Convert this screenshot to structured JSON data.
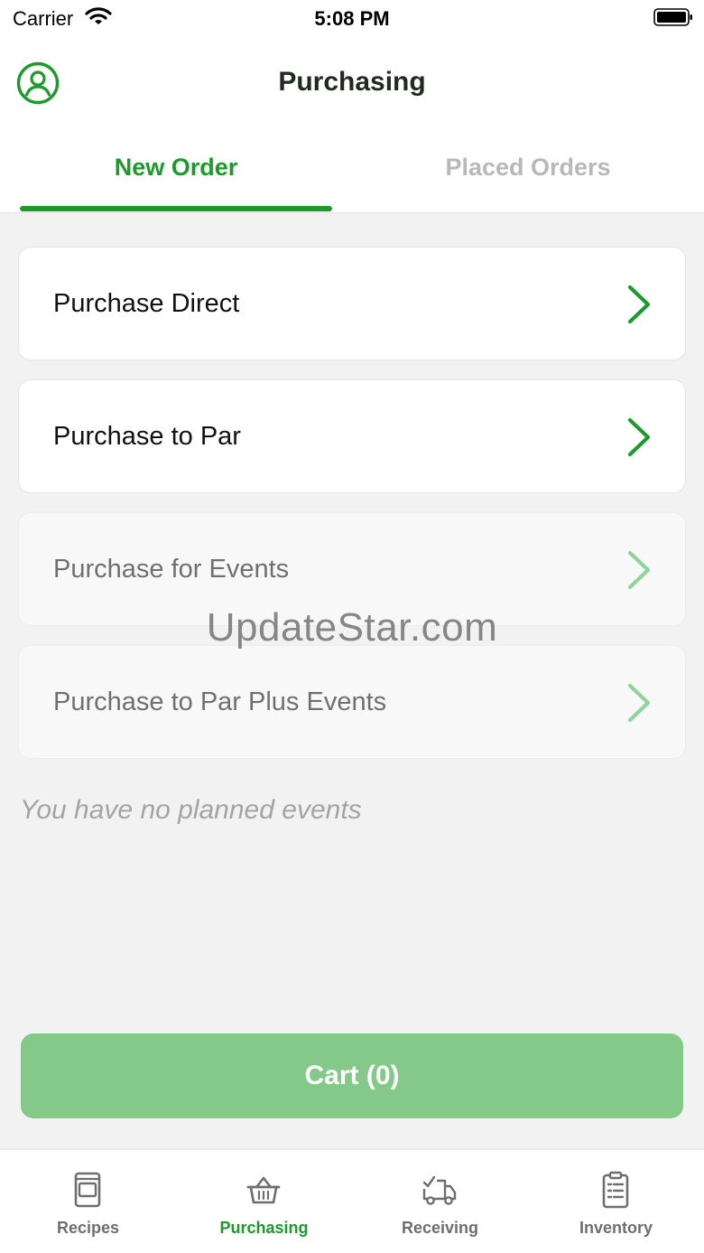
{
  "status_bar": {
    "carrier": "Carrier",
    "time": "5:08 PM"
  },
  "header": {
    "title": "Purchasing",
    "profile_icon": "user-circle-icon"
  },
  "tabs": [
    {
      "label": "New Order",
      "active": true
    },
    {
      "label": "Placed Orders",
      "active": false
    }
  ],
  "options": [
    {
      "label": "Purchase Direct",
      "enabled": true
    },
    {
      "label": "Purchase to Par",
      "enabled": true
    },
    {
      "label": "Purchase for Events",
      "enabled": false
    },
    {
      "label": "Purchase to Par Plus Events",
      "enabled": false
    }
  ],
  "note": "You have no planned events",
  "watermark": "UpdateStar.com",
  "cart_button": {
    "label": "Cart (0)"
  },
  "tabbar": [
    {
      "label": "Recipes",
      "icon": "recipe-book-icon",
      "active": false
    },
    {
      "label": "Purchasing",
      "icon": "basket-icon",
      "active": true
    },
    {
      "label": "Receiving",
      "icon": "delivery-truck-icon",
      "active": false
    },
    {
      "label": "Inventory",
      "icon": "clipboard-icon",
      "active": false
    }
  ],
  "colors": {
    "accent": "#1a9b2a",
    "accent_light": "#84c98a",
    "chevron_disabled": "#8fd49a",
    "inactive_text": "#b8b8b8",
    "background": "#f2f2f2"
  }
}
